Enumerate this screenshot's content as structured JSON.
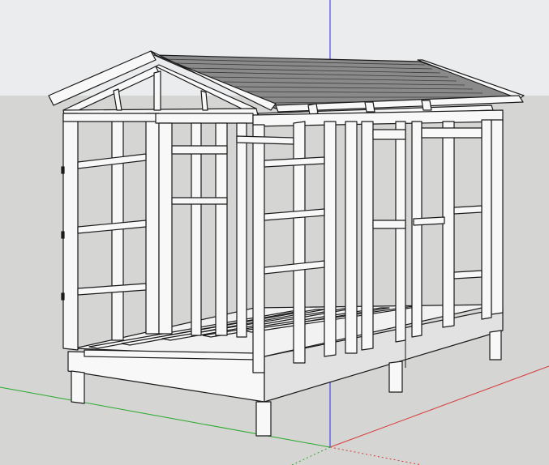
{
  "viewport": {
    "sky_color": "#ebecee",
    "ground_color": "#d5d5d3",
    "axis_colors": {
      "blue": "#2a2ae8",
      "red": "#d63a3a",
      "green": "#2aa82a"
    }
  },
  "model": {
    "name": "shed-frame",
    "stroke_color": "#1a1a1a",
    "face_color": "#f8f8f8",
    "roof_color": "#8a8a8a",
    "shade_color": "#e2e2e2"
  }
}
